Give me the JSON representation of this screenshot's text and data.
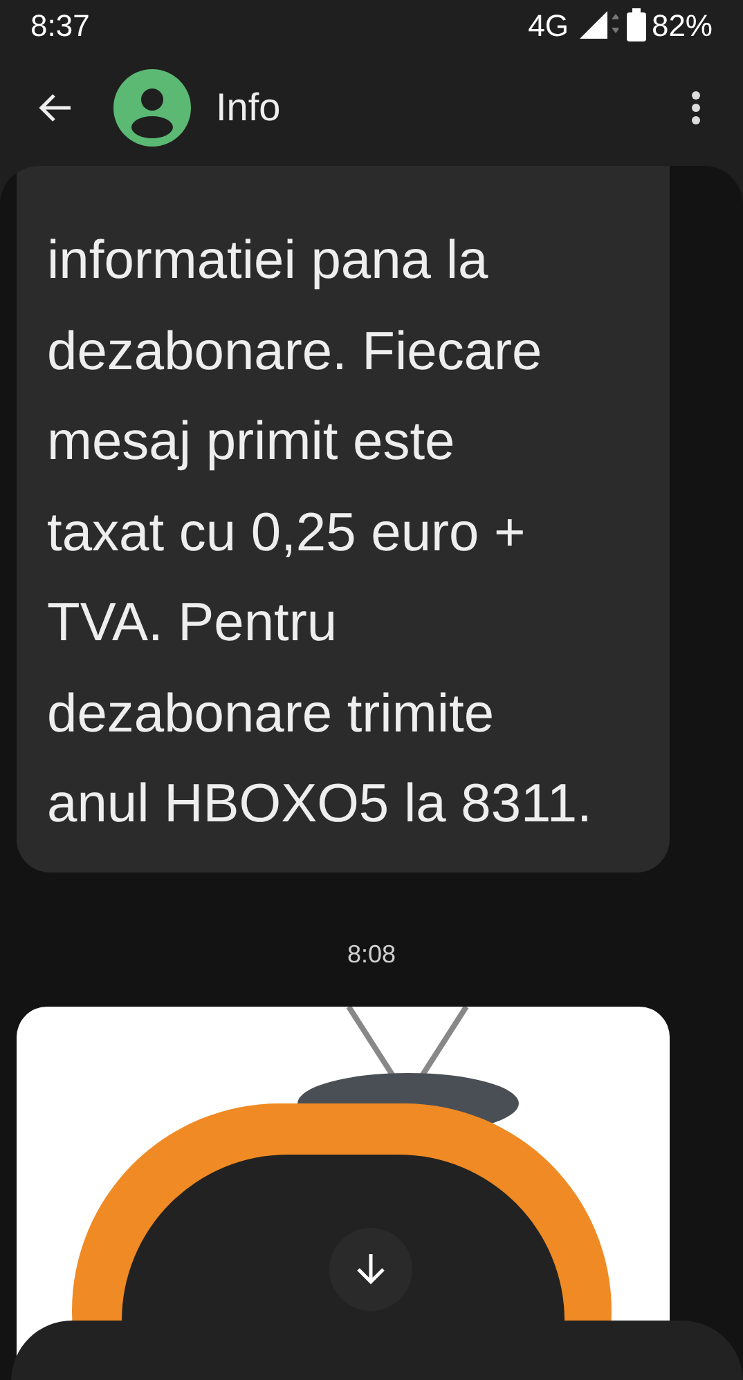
{
  "status_bar": {
    "time": "8:37",
    "network": "4G",
    "battery": "82%"
  },
  "app_bar": {
    "title": "Info"
  },
  "messages": [
    {
      "kind": "text",
      "lines": [
        "informatiei pana la",
        "dezabonare. Fiecare",
        "mesaj primit este",
        "taxat cu 0,25 euro +",
        "TVA. Pentru",
        "dezabonare trimite",
        "anul HBOXO5 la 8311."
      ]
    },
    {
      "kind": "timestamp",
      "text": "8:08"
    },
    {
      "kind": "image"
    }
  ]
}
